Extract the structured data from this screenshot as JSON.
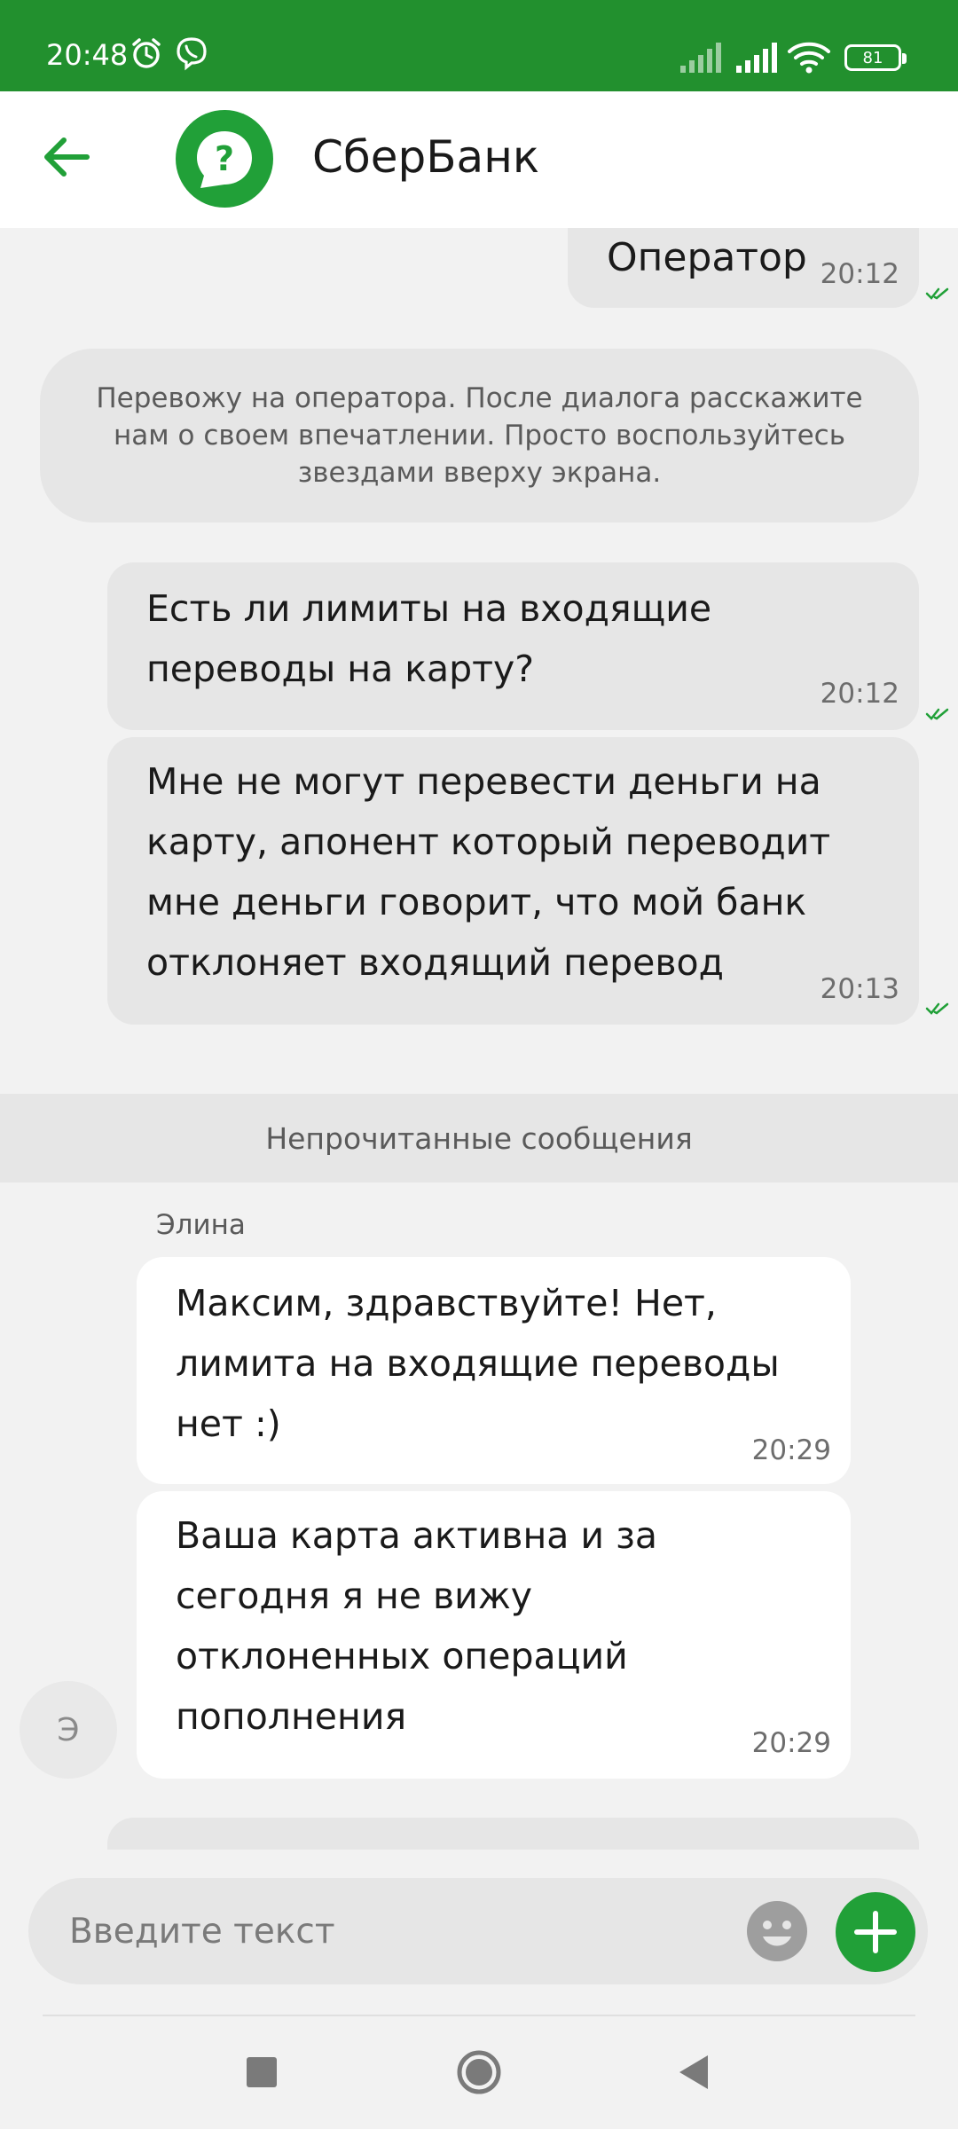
{
  "status_bar": {
    "time": "20:48",
    "battery": "81",
    "icons": [
      "alarm-icon",
      "viber-icon",
      "signal-icon",
      "signal-icon",
      "wifi-icon",
      "battery-icon"
    ]
  },
  "header": {
    "title": "СберБанк",
    "back_icon": "arrow-left-icon",
    "avatar_icon": "help-question-icon"
  },
  "messages": {
    "operator": {
      "text": "Оператор",
      "time": "20:12"
    },
    "system": {
      "text": "Перевожу на оператора. После диалога расскажите нам о своем впечатлении. Просто воспользуйтесь звездами вверху экрана."
    },
    "out_1": {
      "line1": "Есть ли лимиты на входящие",
      "line2": "переводы на карту?",
      "time": "20:12"
    },
    "out_2": {
      "line1": "Мне не могут перевести деньги на",
      "line2": "карту, апонент который переводит",
      "line3": "мне деньги говорит, что мой банк",
      "line4": "отклоняет входящий перевод",
      "time": "20:13"
    },
    "unread_divider": "Непрочитанные сообщения",
    "sender_name": "Элина",
    "sender_initial": "Э",
    "in_1": {
      "line1": "Максим, здравствуйте! Нет,",
      "line2": "лимита на входящие переводы",
      "line3": "нет :)",
      "time": "20:29"
    },
    "in_2": {
      "line1": "Ваша карта активна и за",
      "line2": "сегодня я не вижу",
      "line3": "отклоненных операций",
      "line4": "пополнения",
      "time": "20:29"
    }
  },
  "input": {
    "placeholder": "Введите текст",
    "emoji_icon": "emoji-icon",
    "add_icon": "plus-icon"
  },
  "nav_bar": {
    "icons": [
      "recents-square-icon",
      "home-circle-icon",
      "back-triangle-icon"
    ]
  },
  "colors": {
    "brand_green": "#21a038",
    "status_bar_green": "#22902e",
    "check_green": "#21a038"
  }
}
